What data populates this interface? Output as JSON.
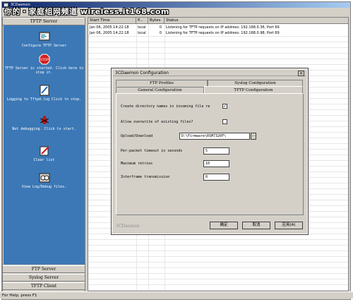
{
  "watermark": "你的・家庭组网频道 wireless.it168.com",
  "app": {
    "title": "3CDaemon"
  },
  "sidebar": {
    "top_tab": "TFTP Server",
    "items": [
      {
        "label": "Configure TFTP Server",
        "icon": "configure-icon"
      },
      {
        "label": "TFTP Server is started. Click here to stop it.",
        "icon": "stop-icon"
      },
      {
        "label": "Logging to Tftpd.log Click to stop.",
        "icon": "log-icon"
      },
      {
        "label": "Not debugging. Click to start.",
        "icon": "bug-icon"
      },
      {
        "label": "Clear list",
        "icon": "clear-list-icon"
      },
      {
        "label": "View Log/Debug files.",
        "icon": "view-log-icon"
      }
    ],
    "bottom_tabs": [
      "FTP Server",
      "Syslog Server",
      "TFTP Client"
    ]
  },
  "log": {
    "columns": [
      "Start Time",
      "P...",
      "Bytes",
      "Status"
    ],
    "rows": [
      {
        "time": "Jan 06, 2005 14:22:18",
        "peer": "local",
        "bytes": "0",
        "status": "Listening for TFTP requests on IP address: 192.168.0.36, Port 69"
      },
      {
        "time": "Jan 06, 2005 14:22:18",
        "peer": "local",
        "bytes": "0",
        "status": "Listening for TFTP requests on IP address: 192.168.0.98, Port 69"
      }
    ]
  },
  "status_bar": "For Help, press F1",
  "dialog": {
    "title": "3CDaemon Configuration",
    "close": "×",
    "tabs_back": [
      "FTP Profiles",
      "Syslog Configuration"
    ],
    "tabs_front": [
      "General Configuration",
      "TFTP Configuration"
    ],
    "fields": {
      "create_dirs": {
        "label": "Create directory names in incoming file re",
        "checked": "✓"
      },
      "allow_overwrite": {
        "label": "Allow overwrite of existing files?",
        "checked": ""
      },
      "upload_download": {
        "label": "Upload/Download",
        "value": "D:\\Firmware\\RSM7320F\\",
        "browse": "..."
      },
      "timeout": {
        "label": "Per-packet timeout in seconds",
        "value": "5"
      },
      "retries": {
        "label": "Maximum retries",
        "value": "10"
      },
      "interframe": {
        "label": "Interframe transmission",
        "value": "0"
      }
    },
    "brand": "3CDaemon",
    "buttons": {
      "ok": "确定",
      "cancel": "取消",
      "apply": "应用(A)"
    }
  }
}
